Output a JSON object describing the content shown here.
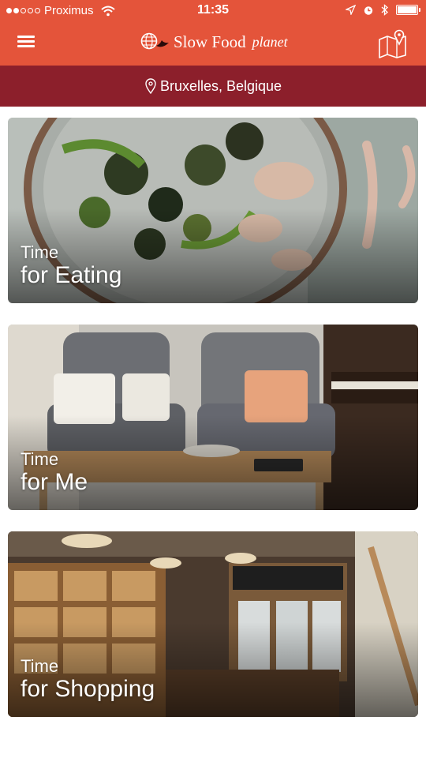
{
  "status_bar": {
    "carrier": "Proximus",
    "time": "11:35"
  },
  "header": {
    "logo_text": "Slow Food",
    "logo_suffix": "planet"
  },
  "location": {
    "label": "Bruxelles, Belgique"
  },
  "cards": [
    {
      "line1": "Time",
      "line2": "for Eating"
    },
    {
      "line1": "Time",
      "line2": "for Me"
    },
    {
      "line1": "Time",
      "line2": "for Shopping"
    }
  ],
  "colors": {
    "header": "#e4543a",
    "location_bar": "#8c1f2b"
  }
}
